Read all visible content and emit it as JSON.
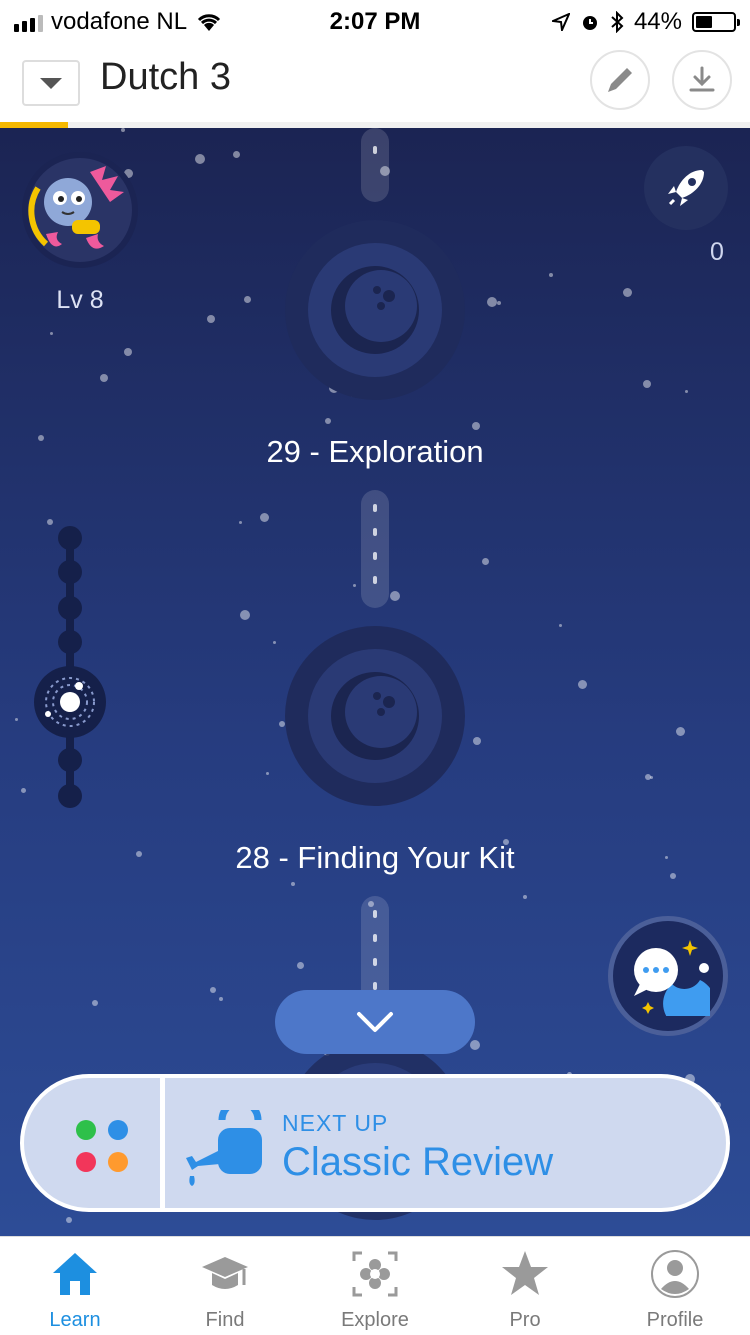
{
  "status_bar": {
    "carrier": "vodafone NL",
    "time": "2:07 PM",
    "battery": "44%"
  },
  "header": {
    "title": "Dutch 3",
    "course_progress": 0.09
  },
  "avatar": {
    "level": "Lv 8"
  },
  "rocket": {
    "count": "0"
  },
  "lessons": [
    {
      "label": "29 - Exploration"
    },
    {
      "label": "28 - Finding Your Kit"
    }
  ],
  "next_up": {
    "label": "NEXT UP",
    "title": "Classic Review"
  },
  "tabs": [
    {
      "label": "Learn",
      "icon": "home-icon",
      "active": true
    },
    {
      "label": "Find",
      "icon": "graduation-cap-icon",
      "active": false
    },
    {
      "label": "Explore",
      "icon": "flower-icon",
      "active": false
    },
    {
      "label": "Pro",
      "icon": "star-icon",
      "active": false
    },
    {
      "label": "Profile",
      "icon": "profile-icon",
      "active": false
    }
  ],
  "colors": {
    "accent": "#2e8fe6",
    "progress": "#f5b800",
    "space_top": "#1b2453",
    "space_bottom": "#2d4c96"
  }
}
